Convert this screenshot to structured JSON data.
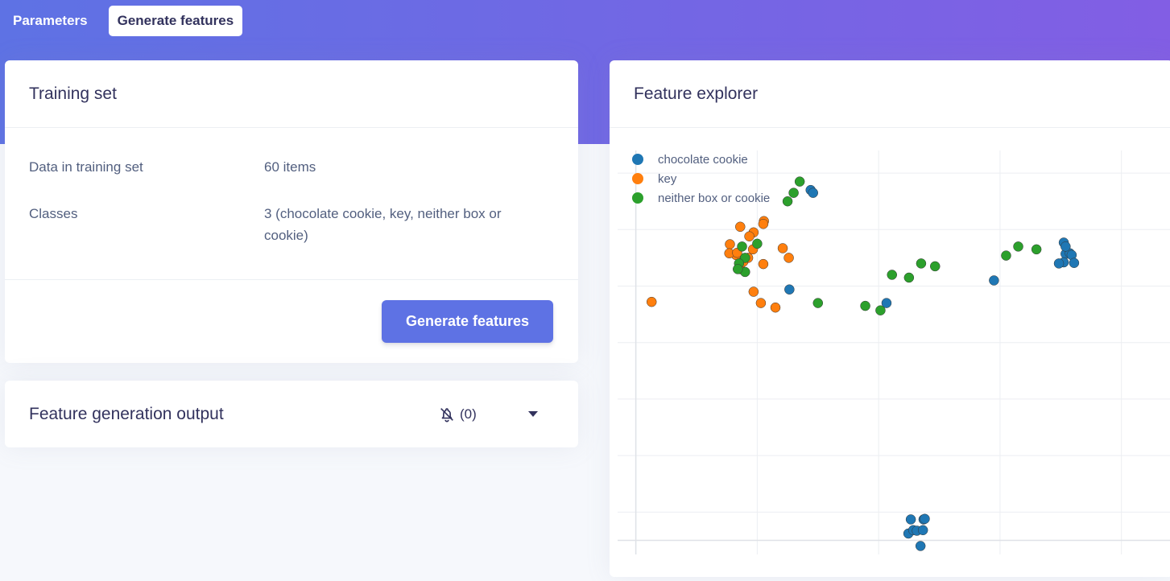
{
  "tabs": {
    "parameters": "Parameters",
    "generate_features": "Generate features"
  },
  "training_card": {
    "title": "Training set",
    "data_label": "Data in training set",
    "data_value": "60 items",
    "classes_label": "Classes",
    "classes_value": "3 (chocolate cookie, key, neither box or cookie)",
    "button_label": "Generate features"
  },
  "output_card": {
    "title": "Feature generation output",
    "notification_count": "(0)"
  },
  "explorer_card": {
    "title": "Feature explorer"
  },
  "colors": {
    "accent": "#5e72e4",
    "gradient_end": "#825ee4",
    "chocolate_cookie": "#1f77b4",
    "key": "#ff7f0e",
    "neither": "#2ca02c"
  },
  "chart_data": {
    "type": "scatter",
    "grid": true,
    "legend_position": "top-left",
    "xlim": [
      -1.8,
      7.3
    ],
    "ylim": [
      -5.25,
      1.9
    ],
    "series": [
      {
        "name": "chocolate cookie",
        "color": "#1f77b4",
        "points": [
          [
            1.38,
            1.2
          ],
          [
            1.42,
            1.15
          ],
          [
            1.03,
            -0.56
          ],
          [
            5.55,
            0.27
          ],
          [
            5.58,
            0.07
          ],
          [
            5.65,
            0.08
          ],
          [
            5.55,
            -0.08
          ],
          [
            5.58,
            0.2
          ],
          [
            5.68,
            0.05
          ],
          [
            5.72,
            -0.09
          ],
          [
            5.47,
            -0.1
          ],
          [
            2.63,
            -0.8
          ],
          [
            4.4,
            -0.4
          ],
          [
            3.03,
            -4.63
          ],
          [
            3.24,
            -4.63
          ],
          [
            3.26,
            -4.62
          ],
          [
            2.99,
            -4.88
          ],
          [
            3.07,
            -4.82
          ],
          [
            3.13,
            -4.83
          ],
          [
            3.23,
            -4.82
          ],
          [
            3.19,
            -5.1
          ]
        ]
      },
      {
        "name": "key",
        "color": "#ff7f0e",
        "points": [
          [
            0.61,
            0.65
          ],
          [
            0.44,
            0.45
          ],
          [
            0.05,
            0.24
          ],
          [
            0.15,
            0.05
          ],
          [
            0.35,
            0.0
          ],
          [
            0.37,
            0.38
          ],
          [
            0.43,
            0.15
          ],
          [
            0.56,
            -0.8
          ],
          [
            0.04,
            0.08
          ],
          [
            1.02,
            0.0
          ],
          [
            0.22,
            -0.2
          ],
          [
            0.17,
            0.09
          ],
          [
            0.22,
            0.55
          ],
          [
            0.92,
            0.17
          ],
          [
            0.27,
            -0.07
          ],
          [
            0.6,
            -0.11
          ],
          [
            0.44,
            -0.6
          ],
          [
            0.8,
            -0.88
          ],
          [
            -1.24,
            -0.78
          ],
          [
            0.6,
            0.6
          ]
        ]
      },
      {
        "name": "neither box or cookie",
        "color": "#2ca02c",
        "points": [
          [
            1.2,
            1.35
          ],
          [
            1.1,
            1.15
          ],
          [
            1.0,
            1.0
          ],
          [
            0.25,
            0.2
          ],
          [
            0.5,
            0.25
          ],
          [
            0.3,
            0.0
          ],
          [
            0.2,
            -0.1
          ],
          [
            0.3,
            -0.25
          ],
          [
            1.5,
            -0.8
          ],
          [
            0.18,
            -0.2
          ],
          [
            2.28,
            -0.85
          ],
          [
            2.53,
            -0.93
          ],
          [
            2.72,
            -0.3
          ],
          [
            3.0,
            -0.35
          ],
          [
            3.2,
            -0.1
          ],
          [
            3.43,
            -0.15
          ],
          [
            4.6,
            0.04
          ],
          [
            4.8,
            0.2
          ],
          [
            5.1,
            0.15
          ]
        ]
      }
    ]
  }
}
